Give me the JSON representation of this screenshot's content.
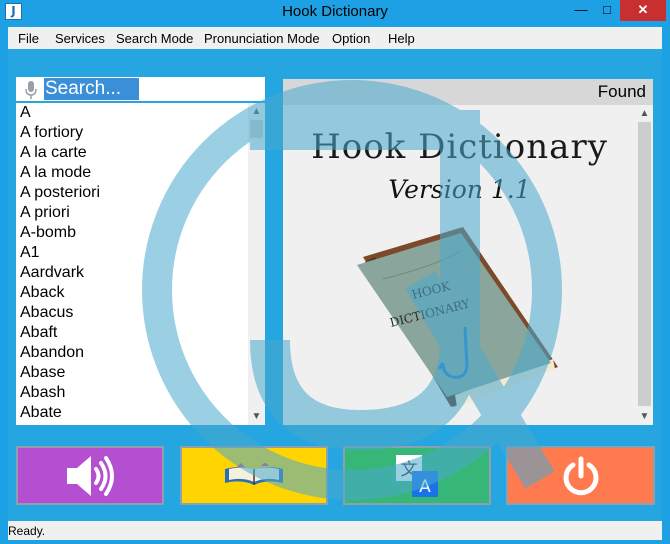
{
  "window": {
    "title": "Hook Dictionary",
    "app_icon_letter": "J",
    "controls": {
      "minimize": "—",
      "maximize": "□",
      "close": "✕"
    }
  },
  "menu": [
    "File",
    "Services",
    "Search Mode",
    "Pronunciation Mode",
    "Option",
    "Help"
  ],
  "search": {
    "placeholder": "Search...",
    "value": "",
    "icon": "mic-icon"
  },
  "words": [
    "A",
    "A fortiory",
    "A la carte",
    "A la mode",
    "A posteriori",
    "A priori",
    "A-bomb",
    "A1",
    "Aardvark",
    "Aback",
    "Abacus",
    "Abaft",
    "Abandon",
    "Abase",
    "Abash",
    "Abate"
  ],
  "found": {
    "label": "Found"
  },
  "splash": {
    "title": "Hook Dictionary",
    "version": "Version 1.1",
    "book_line1": "HOOK",
    "book_line2": "DICTIONARY",
    "book_mark": "J"
  },
  "buttons": {
    "speak": {
      "icon": "speaker-icon",
      "color": "#b54fd1"
    },
    "read": {
      "icon": "open-book-icon",
      "color": "#ffd400"
    },
    "translate": {
      "icon": "translate-icon",
      "glyph_top": "文",
      "glyph_bottom": "A",
      "color": "#36b777"
    },
    "power": {
      "icon": "power-icon",
      "color": "#ff7a4e"
    }
  },
  "status": {
    "text": "Ready."
  },
  "colors": {
    "accent": "#1da1e4",
    "close": "#c7302e"
  }
}
